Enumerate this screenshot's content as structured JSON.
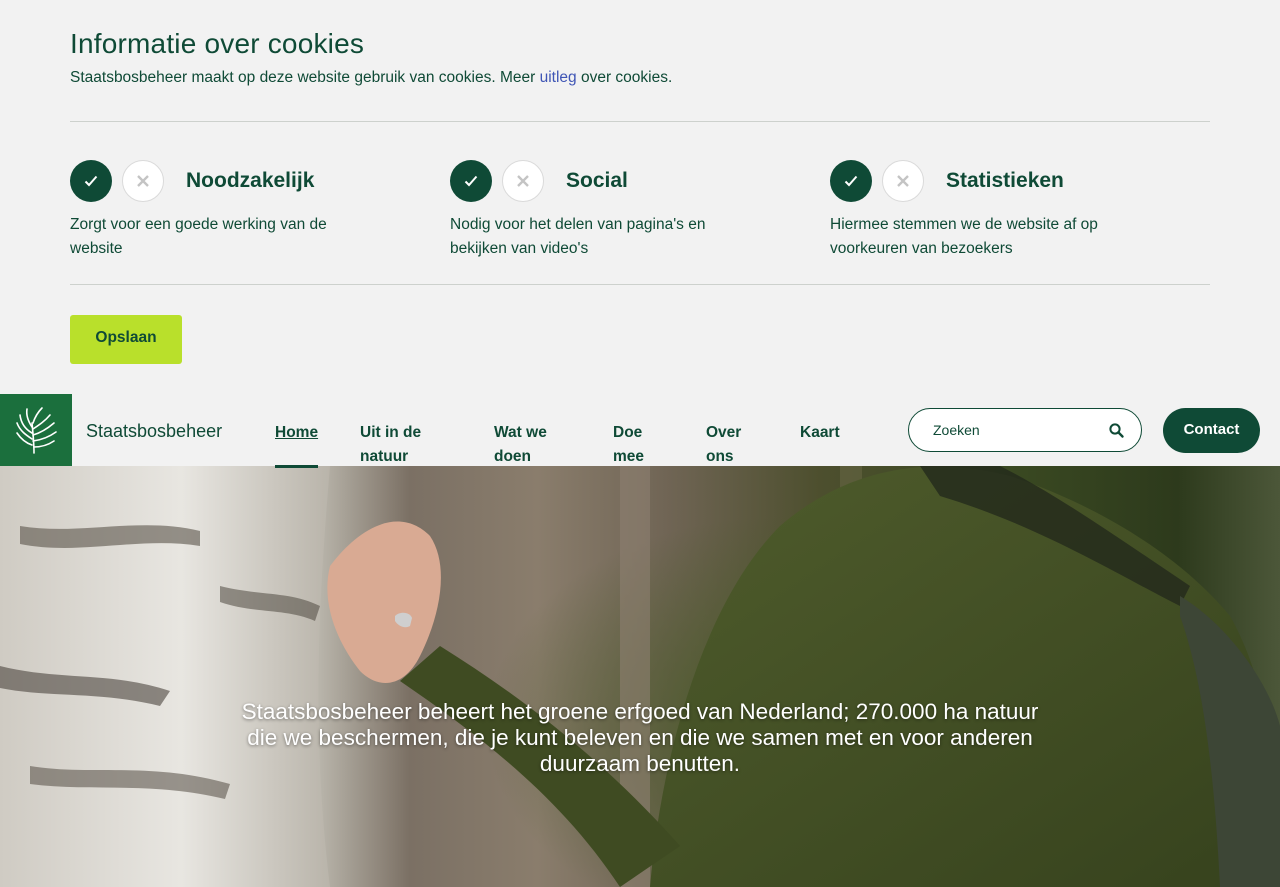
{
  "cookie": {
    "title": "Informatie over cookies",
    "intro_before": "Staatsbosbeheer maakt op deze website gebruik van cookies. Meer ",
    "intro_link": "uitleg",
    "intro_after": " over cookies.",
    "categories": [
      {
        "name": "Noodzakelijk",
        "description": "Zorgt voor een goede werking van de website",
        "accepted": true
      },
      {
        "name": "Social",
        "description": "Nodig voor het delen van pagina's en bekijken van video's",
        "accepted": true
      },
      {
        "name": "Statistieken",
        "description": "Hiermee stemmen we de website af op voorkeuren van bezoekers",
        "accepted": true
      }
    ],
    "save_label": "Opslaan"
  },
  "nav": {
    "brand": "Staatsbosbeheer",
    "items": [
      {
        "line1": "Home",
        "line2": "",
        "active": true
      },
      {
        "line1": "Uit in de",
        "line2": "natuur"
      },
      {
        "line1": "Wat we",
        "line2": "doen"
      },
      {
        "line1": "Doe",
        "line2": "mee"
      },
      {
        "line1": "Over",
        "line2": "ons"
      },
      {
        "line1": "Kaart",
        "line2": ""
      }
    ],
    "search_placeholder": "Zoeken",
    "contact_label": "Contact"
  },
  "hero": {
    "caption": "Staatsbosbeheer beheert het groene erfgoed van Nederland; 270.000 ha natuur die we beschermen, die je kunt beleven en die we samen met en voor anderen duurzaam benutten."
  },
  "colors": {
    "primary": "#0f4a36",
    "accent": "#b9e02b",
    "logo_bg": "#1b6f3d",
    "link": "#3f55b5",
    "banner_bg": "#f2f2f2"
  },
  "icons": {
    "accept": "check-icon",
    "reject": "close-icon",
    "search": "search-icon",
    "logo": "tree-logo-icon"
  }
}
